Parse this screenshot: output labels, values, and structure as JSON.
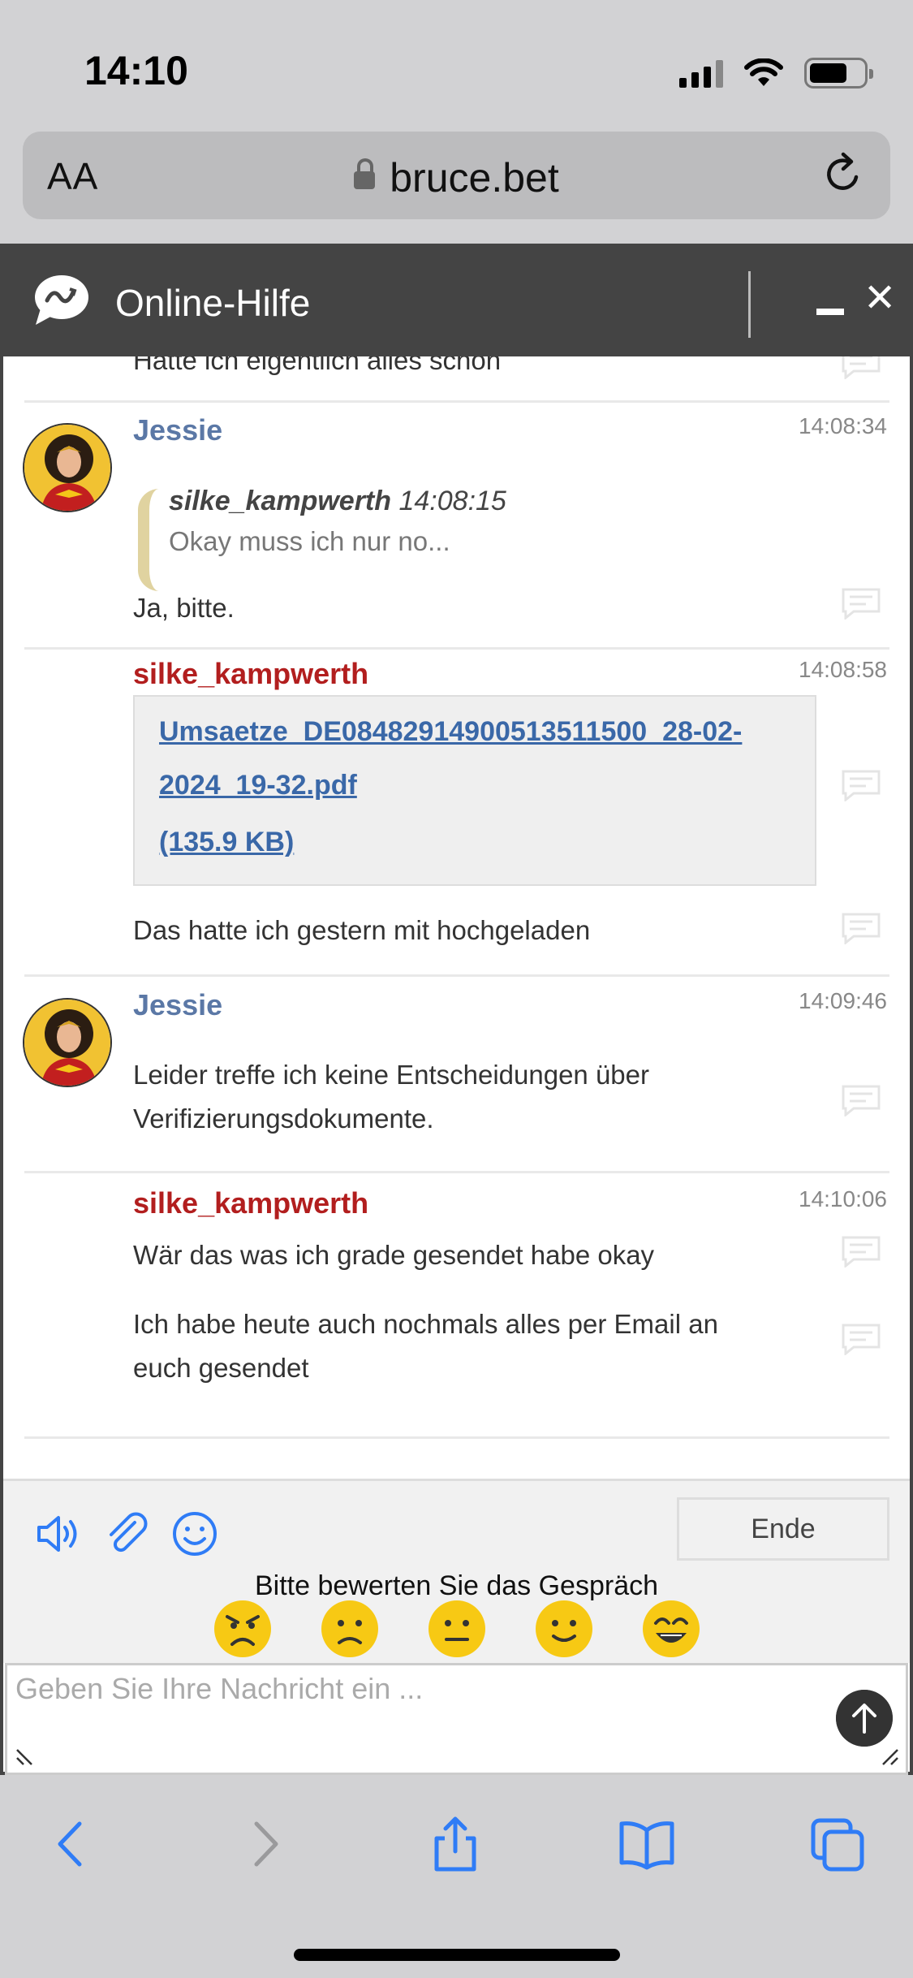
{
  "status_bar": {
    "time": "14:10"
  },
  "browser": {
    "text_size_label": "AA",
    "url": "bruce.bet"
  },
  "chat": {
    "title": "Online-Hilfe",
    "messages": {
      "partial_top": "Hatte ich eigentlich alles schon",
      "m1": {
        "sender": "Jessie",
        "time": "14:08:34",
        "quote_sender": "silke_kampwerth",
        "quote_time": "14:08:15",
        "quote_text": "Okay muss ich nur no...",
        "text": "Ja, bitte."
      },
      "m2": {
        "sender": "silke_kampwerth",
        "time": "14:08:58",
        "file_name": "Umsaetze_DE08482914900513511500_28-02-2024_19-32.pdf",
        "file_size": "(135.9 KB)",
        "text": "Das hatte ich gestern mit hochgeladen"
      },
      "m3": {
        "sender": "Jessie",
        "time": "14:09:46",
        "text_line1": "Leider treffe ich keine Entscheidungen über",
        "text_line2": "Verifizierungsdokumente."
      },
      "m4": {
        "sender": "silke_kampwerth",
        "time": "14:10:06",
        "text1": "Wär das was ich grade gesendet habe okay",
        "text2_line1": "Ich habe heute auch nochmals alles per Email an",
        "text2_line2": "euch gesendet"
      }
    },
    "toolbar": {
      "end_label": "Ende",
      "rating_prompt": "Bitte bewerten Sie das Gespräch"
    },
    "input": {
      "placeholder": "Geben Sie Ihre Nachricht ein ...",
      "value": ""
    }
  },
  "colors": {
    "agent_name": "#5b78a6",
    "user_name": "#b21e1e",
    "header_bg": "#444444",
    "link": "#3a68a8",
    "ios_blue": "#2f7cf6",
    "smiley_yellow": "#f7c914"
  }
}
